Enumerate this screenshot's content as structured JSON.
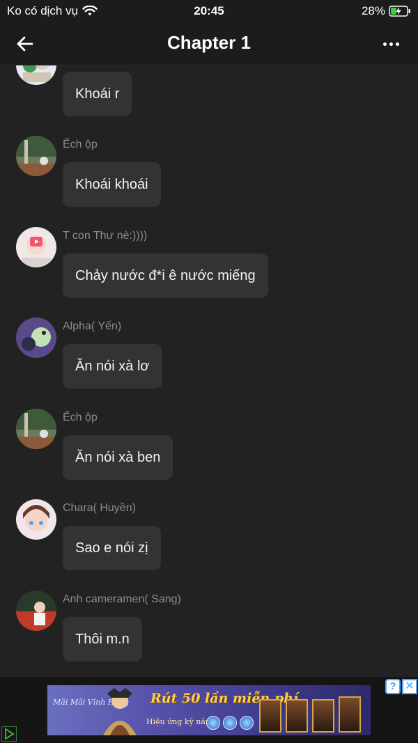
{
  "status_bar": {
    "carrier": "Ko có dịch vụ",
    "time": "20:45",
    "battery": "28%"
  },
  "nav": {
    "title": "Chapter 1",
    "back_icon": "arrow-left-icon",
    "more_icon": "more-horizontal-icon"
  },
  "messages": [
    {
      "sender": "",
      "text": "Khoái r"
    },
    {
      "sender": "Ếch ộp",
      "text": "Khoái khoái"
    },
    {
      "sender": "T con Thư nè:))))",
      "text": "Chảy nước đ*i ê nước miếng"
    },
    {
      "sender": "Alpha( Yến)",
      "text": "Ăn nói xà lơ"
    },
    {
      "sender": "Ếch ộp",
      "text": "Ăn nói xà ben"
    },
    {
      "sender": "Chara( Huyền)",
      "text": "Sao e nói zị"
    },
    {
      "sender": "Anh cameramen( Sang)",
      "text": "Thôi m.n"
    }
  ],
  "ad": {
    "headline": "Rút 50 lần miễn phí",
    "subtext": "Hiệu ứng kỹ năng:",
    "logo": "Mãi Mãi Vĩnh Hằng",
    "info_icon": "?",
    "close_icon": "✕"
  },
  "colors": {
    "background": "#222222",
    "bubble": "#333333",
    "sender_text": "#8c8c8c"
  }
}
